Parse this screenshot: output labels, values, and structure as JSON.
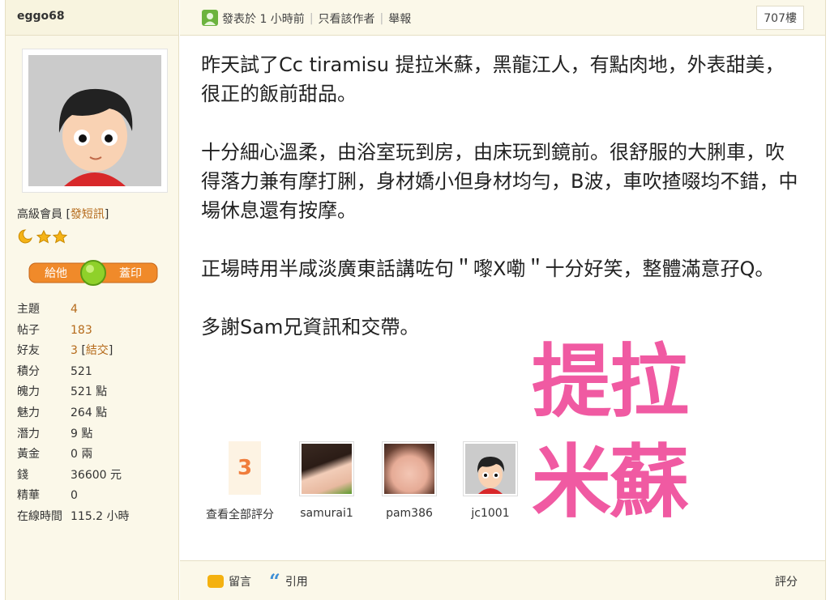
{
  "user": {
    "name": "eggo68",
    "rank": "高級會員",
    "pm_link": "發短訊",
    "stamp_label_left": "給他",
    "stamp_label_right": "蓋印",
    "stats": [
      {
        "key": "主題",
        "value": "4",
        "link": true
      },
      {
        "key": "帖子",
        "value": "183",
        "link": true
      },
      {
        "key": "好友",
        "value": "3",
        "extra": "結交",
        "link": true
      },
      {
        "key": "積分",
        "value": "521"
      },
      {
        "key": "魄力",
        "value": "521 點"
      },
      {
        "key": "魅力",
        "value": "264 點"
      },
      {
        "key": "潛力",
        "value": "9 點"
      },
      {
        "key": "黃金",
        "value": "0 兩"
      },
      {
        "key": "錢",
        "value": "36600 元"
      },
      {
        "key": "精華",
        "value": "0"
      },
      {
        "key": "在線時間",
        "value": "115.2 小時"
      }
    ]
  },
  "post": {
    "posted": "發表於 1 小時前",
    "only_author": "只看該作者",
    "report": "舉報",
    "floor": "707樓",
    "paragraphs": [
      "昨天試了Cc tiramisu 提拉米蘇，黑龍江人，有點肉地，外表甜美，很正的飯前甜品。",
      "十分細心溫柔，由浴室玩到房，由床玩到鏡前。很舒服的大脷車，吹得落力兼有摩打脷，身材嬌小但身材均勻，B波，車吹揸啜均不錯，中場休息還有按摩。",
      "正場時用半咸淡廣東話講咗句＂嚟X嘞＂十分好笑，整體滿意孖Q。",
      "多謝Sam兄資訊和交帶。"
    ],
    "rating_count": "3",
    "rating_view_all": "查看全部評分",
    "raters": [
      "samurai1",
      "pam386",
      "jc1001"
    ],
    "watermark_line1": "提拉",
    "watermark_line2": "米蘇"
  },
  "footer": {
    "reply": "留言",
    "quote": "引用",
    "rate": "評分"
  },
  "colors": {
    "accent_pink": "#f05aa2",
    "link_brown": "#b56a1a",
    "rating_orange": "#f07d3c"
  }
}
